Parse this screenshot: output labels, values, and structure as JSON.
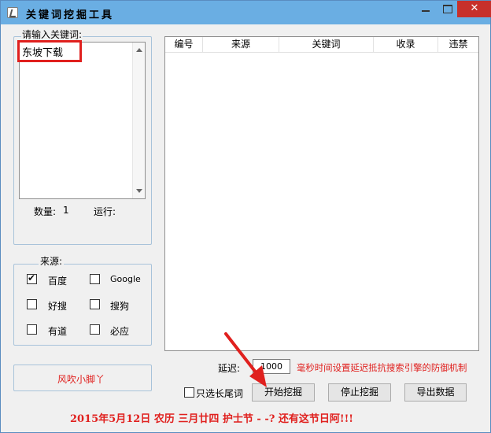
{
  "window": {
    "title": "关键词挖掘工具",
    "close_label": "✕"
  },
  "keyword_panel": {
    "label": "请输入关键词:",
    "keyword_value": "东坡下载",
    "count_label": "数量:",
    "count_value": "1",
    "running_label": "运行:"
  },
  "source_panel": {
    "label": "来源:",
    "options": [
      {
        "label": "百度",
        "checked": true
      },
      {
        "label": "Google",
        "checked": false
      },
      {
        "label": "好搜",
        "checked": false
      },
      {
        "label": "搜狗",
        "checked": false
      },
      {
        "label": "有道",
        "checked": false
      },
      {
        "label": "必应",
        "checked": false
      }
    ]
  },
  "author_box": {
    "text": "风吹小脚丫"
  },
  "table": {
    "columns": [
      "编号",
      "来源",
      "关键词",
      "收录",
      "违禁"
    ]
  },
  "controls": {
    "delay_label": "延迟:",
    "delay_value": "1000",
    "delay_hint": "毫秒时间设置延迟抵抗搜索引擎的防御机制",
    "long_tail_label": "只选长尾词",
    "long_tail_checked": false,
    "start_button": "开始挖掘",
    "stop_button": "停止挖掘",
    "export_button": "导出数据"
  },
  "footer": {
    "text": "2015年5月12日 农历 三月廿四 护士节 - -? 还有这节日阿!!!"
  },
  "colors": {
    "titlebar": "#6aaee3",
    "close_button": "#c7302b",
    "highlight": "#e0201e",
    "panel_border": "#a8c3da"
  }
}
